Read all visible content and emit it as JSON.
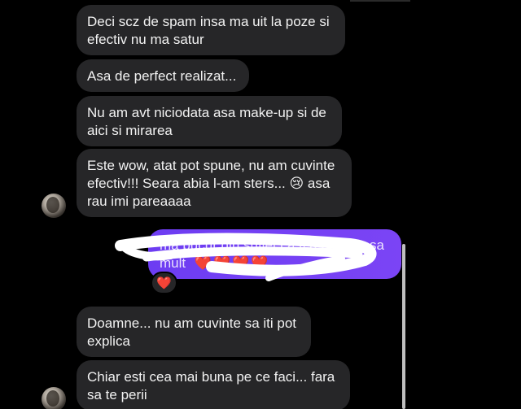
{
  "messages_received_top": [
    {
      "text": "Deci scz de spam insa ma uit la poze si\nefectiv nu ma satur"
    },
    {
      "text": "Asa de perfect realizat..."
    },
    {
      "text": "Nu am avt niciodata asa make-up si de\naici si mirarea"
    },
    {
      "text": "Este wow, atat pot spune, nu am cuvinte\nefectiv!!! Seara abia l-am sters... 😢 asa\nrau imi pareaaaa"
    }
  ],
  "sent_message": {
    "text": "ma bucur din suflet ca ti a placut asa",
    "text_line2": "mult",
    "hearts": "❤️❤️❤️❤️",
    "reaction": "❤️"
  },
  "messages_received_bottom": [
    {
      "text": "Doamne... nu am cuvinte sa iti pot\nexplica"
    },
    {
      "text": "Chiar esti cea mai buna pe ce faci... fara\nsa te perii"
    }
  ],
  "colors": {
    "background": "#000000",
    "received_bubble": "#262628",
    "sent_bubble": "#7040f3",
    "heart": "#ff2e4d"
  }
}
